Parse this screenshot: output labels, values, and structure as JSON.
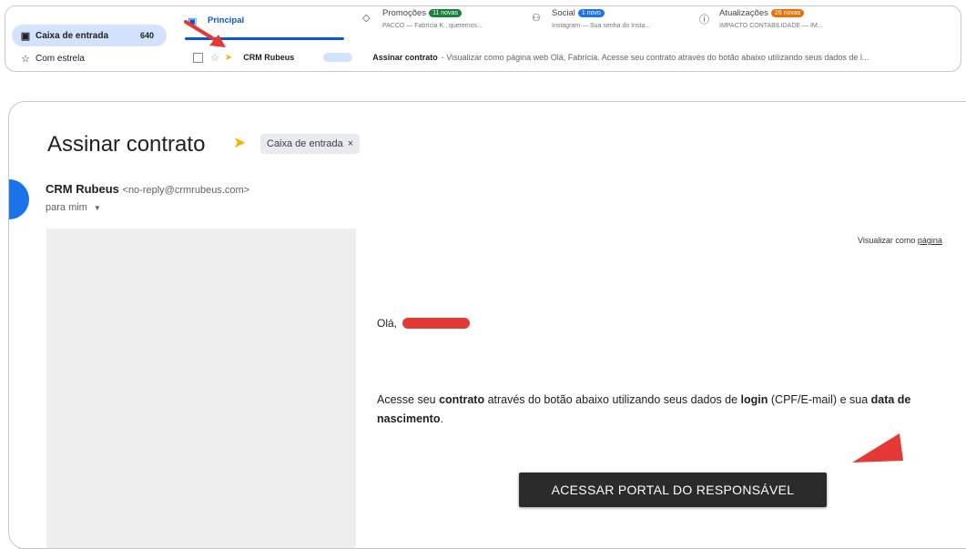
{
  "inbox": {
    "nav": [
      {
        "label": "Caixa de entrada",
        "count": "640",
        "icon": "inbox-icon"
      },
      {
        "label": "Com estrela",
        "count": "",
        "icon": "star-icon"
      }
    ],
    "tabs": [
      {
        "label": "Principal",
        "badge": "",
        "snippet": "",
        "icon": "inbox-tab-icon"
      },
      {
        "label": "Promoções",
        "badge": "11 novas",
        "snippet": "PACCO — Fabrícia K., queremos...",
        "icon": "tag-icon",
        "badge_color": "#188038"
      },
      {
        "label": "Social",
        "badge": "1 novo",
        "snippet": "Instagram — Sua senha do Insta...",
        "icon": "people-icon",
        "badge_color": "#1a73e8"
      },
      {
        "label": "Atualizações",
        "badge": "26 novas",
        "snippet": "IMPACTO CONTABILIDADE — IM...",
        "icon": "info-icon",
        "badge_color": "#e8710a"
      }
    ],
    "row": {
      "sender": "CRM Rubeus",
      "subject": "Assinar contrato",
      "snippet": " - Visualizar como página web Olá, Fabrícia. Acesse seu contrato através do botão abaixo utilizando seus dados de l..."
    }
  },
  "message": {
    "subject": "Assinar contrato",
    "label": "Caixa de entrada",
    "label_close": "×",
    "sender_name": "CRM Rubeus",
    "sender_email": "<no-reply@crmrubeus.com>",
    "recipient": "para mim",
    "view_web_prefix": "Visualizar como ",
    "view_web_link": "página",
    "greeting": "Olá,",
    "body": {
      "p1": "Acesse seu ",
      "b1": "contrato",
      "p2": " através do botão abaixo utilizando seus dados de ",
      "b2": "login",
      "p3": " (CPF/E-mail) e sua ",
      "b3": "data de nascimento",
      "p4": "."
    },
    "cta_label": "ACESSAR PORTAL DO RESPONSÁVEL"
  },
  "colors": {
    "accent": "#0b57d0",
    "inbox_selected": "#d3e3fd",
    "annotation_arrow": "#e53935",
    "importance_marker": "#f4b400"
  }
}
